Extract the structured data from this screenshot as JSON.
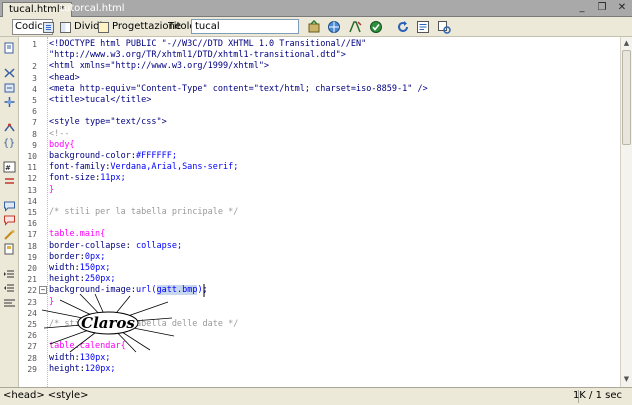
{
  "tabs": [
    {
      "label": "tucal.html*",
      "active": true
    },
    {
      "label": "tutorcal.html",
      "active": false
    }
  ],
  "window_buttons": {
    "minimize": "_",
    "restore": "❐",
    "close": "✕"
  },
  "toolbar": {
    "code_label": "Codice",
    "split_label": "Dividi",
    "design_label": "Progettazione",
    "title_label": "Titolo:",
    "title_value": "tucal"
  },
  "editor": {
    "lines": [
      {
        "n": "1",
        "text": "<!DOCTYPE html PUBLIC \"-//W3C//DTD XHTML 1.0 Transitional//EN\""
      },
      {
        "n": "",
        "text": "\"http://www.w3.org/TR/xhtml1/DTD/xhtml1-transitional.dtd\">"
      },
      {
        "n": "2",
        "text": "<html xmlns=\"http://www.w3.org/1999/xhtml\">"
      },
      {
        "n": "3",
        "text": "<head>"
      },
      {
        "n": "4",
        "text": "<meta http-equiv=\"Content-Type\" content=\"text/html; charset=iso-8859-1\" />"
      },
      {
        "n": "5",
        "text": "<title>tucal</title>"
      },
      {
        "n": "6",
        "text": ""
      },
      {
        "n": "7",
        "text": "<style type=\"text/css\">"
      },
      {
        "n": "8",
        "text": "<!--"
      },
      {
        "n": "9",
        "text": "body{"
      },
      {
        "n": "10",
        "text": "background-color:#FFFFFF;"
      },
      {
        "n": "11",
        "text": "font-family:Verdana,Arial,Sans-serif;"
      },
      {
        "n": "12",
        "text": "font-size:11px;"
      },
      {
        "n": "13",
        "text": "}"
      },
      {
        "n": "14",
        "text": ""
      },
      {
        "n": "15",
        "text": "/* stili per la tabella principale */"
      },
      {
        "n": "16",
        "text": ""
      },
      {
        "n": "17",
        "text": "table.main{"
      },
      {
        "n": "18",
        "text": "border-collapse: collapse;"
      },
      {
        "n": "19",
        "text": "border:0px;"
      },
      {
        "n": "20",
        "text": "width:150px;"
      },
      {
        "n": "21",
        "text": "height:250px;"
      },
      {
        "n": "22",
        "text": "background-image:url(gatt.bmp);"
      },
      {
        "n": "23",
        "text": "}"
      },
      {
        "n": "24",
        "text": ""
      },
      {
        "n": "25",
        "text": "/* stili per la tabella delle date */"
      },
      {
        "n": "26",
        "text": ""
      },
      {
        "n": "27",
        "text": "table.calendar{"
      },
      {
        "n": "28",
        "text": "width:130px;"
      },
      {
        "n": "29",
        "text": "height:120px;"
      }
    ],
    "selected_text": "gatt.bmp"
  },
  "watermark_text": "Claros",
  "status": {
    "tags": [
      "<head>",
      "<style>"
    ],
    "info": "1K / 1 sec"
  },
  "colors": {
    "tag": "#000080",
    "css_selector": "#ff00ff",
    "css_value": "#0000ff",
    "comment": "#999999",
    "selection": "#c6d7ee"
  }
}
